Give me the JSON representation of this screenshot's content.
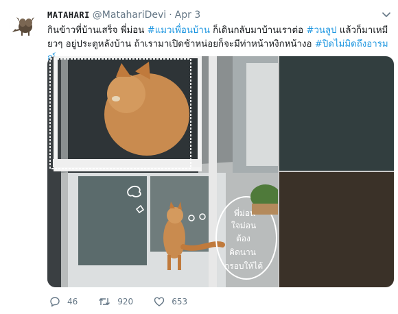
{
  "tweet": {
    "display_name": "MATAHARI",
    "handle": "@MatahariDevi",
    "separator": "·",
    "time": "Apr 3",
    "text_1": "กินข้าวที่บ้านเสร็จ พี่ม่อน ",
    "hashtag_1": "#แมวเพื่อนบ้าน",
    "text_2": " ก็เดินกลับมาบ้านเราต่อ ",
    "hashtag_2": "#วนลูป",
    "text_3": " แล้วก็มาเหมียวๆ อยู่ประตูหลังบ้าน ถ้าเรามาเปิดช้าหน่อยก็จะมีท่าหน้าหงิกหน้างอ ",
    "hashtag_3": "#ปิดไม่มิดถึงอารมณ์",
    "handwriting": [
      "พี่ม่อน",
      "ใจม่อน",
      "ต้อง",
      "คิดนาน",
      "กรอบให้ได้"
    ],
    "replies": "46",
    "retweets": "920",
    "likes": "653"
  },
  "colors": {
    "link": "#1b95e0",
    "meta": "#657786",
    "text": "#14171a"
  }
}
